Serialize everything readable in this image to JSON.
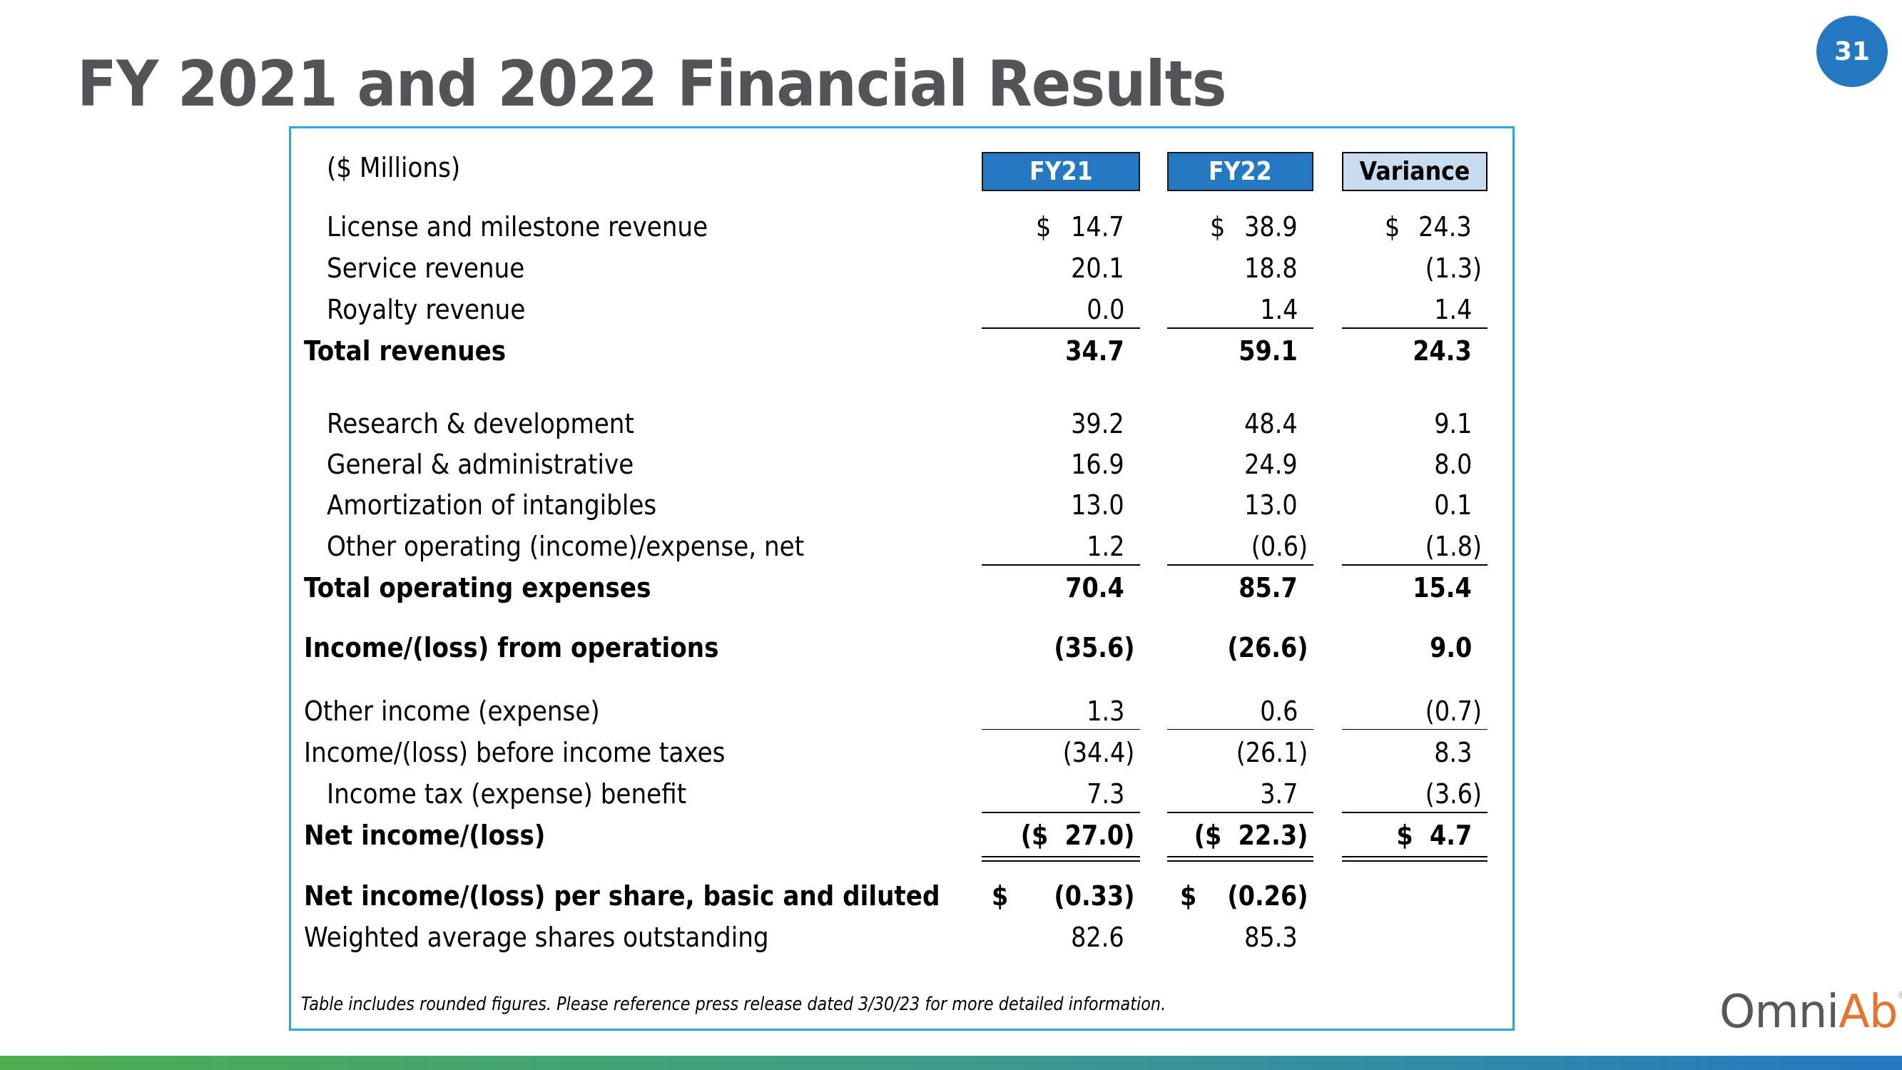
{
  "page": {
    "title": "FY 2021 and 2022 Financial Results",
    "page_number": "31"
  },
  "table": {
    "units_label": "($ Millions)",
    "columns": [
      "FY21",
      "FY22",
      "Variance"
    ],
    "rows": [
      {
        "label": "License and milestone revenue",
        "fy21": {
          "cur": "$",
          "val": "14.7"
        },
        "fy22": {
          "cur": "$",
          "val": "38.9"
        },
        "var": {
          "cur": "$",
          "val": "24.3"
        }
      },
      {
        "label": "Service revenue",
        "fy21": {
          "val": "20.1"
        },
        "fy22": {
          "val": "18.8"
        },
        "var": {
          "val": "(1.3)"
        }
      },
      {
        "label": "Royalty revenue",
        "fy21": {
          "val": "0.0"
        },
        "fy22": {
          "val": "1.4"
        },
        "var": {
          "val": "1.4"
        }
      },
      {
        "label": "Total revenues",
        "fy21": {
          "val": "34.7"
        },
        "fy22": {
          "val": "59.1"
        },
        "var": {
          "val": "24.3"
        }
      },
      {
        "label": "Research & development",
        "fy21": {
          "val": "39.2"
        },
        "fy22": {
          "val": "48.4"
        },
        "var": {
          "val": "9.1"
        }
      },
      {
        "label": "General & administrative",
        "fy21": {
          "val": "16.9"
        },
        "fy22": {
          "val": "24.9"
        },
        "var": {
          "val": "8.0"
        }
      },
      {
        "label": "Amortization of intangibles",
        "fy21": {
          "val": "13.0"
        },
        "fy22": {
          "val": "13.0"
        },
        "var": {
          "val": "0.1"
        }
      },
      {
        "label": "Other operating (income)/expense, net",
        "fy21": {
          "val": "1.2"
        },
        "fy22": {
          "val": "(0.6)"
        },
        "var": {
          "val": "(1.8)"
        }
      },
      {
        "label": "Total operating expenses",
        "fy21": {
          "val": "70.4"
        },
        "fy22": {
          "val": "85.7"
        },
        "var": {
          "val": "15.4"
        }
      },
      {
        "label": "Income/(loss) from operations",
        "fy21": {
          "val": "(35.6)"
        },
        "fy22": {
          "val": "(26.6)"
        },
        "var": {
          "val": "9.0"
        }
      },
      {
        "label": "Other income (expense)",
        "fy21": {
          "val": "1.3"
        },
        "fy22": {
          "val": "0.6"
        },
        "var": {
          "val": "(0.7)"
        }
      },
      {
        "label": "Income/(loss) before income taxes",
        "fy21": {
          "val": "(34.4)"
        },
        "fy22": {
          "val": "(26.1)"
        },
        "var": {
          "val": "8.3"
        }
      },
      {
        "label": "Income tax (expense) benefit",
        "fy21": {
          "val": "7.3"
        },
        "fy22": {
          "val": "3.7"
        },
        "var": {
          "val": "(3.6)"
        }
      },
      {
        "label": "Net income/(loss)",
        "fy21": {
          "val": "($  27.0)"
        },
        "fy22": {
          "val": "($  22.3)"
        },
        "var": {
          "val": "$  4.7"
        }
      },
      {
        "label": "Net income/(loss) per share, basic and diluted",
        "fy21": {
          "cur": "$",
          "val": "(0.33)"
        },
        "fy22": {
          "cur": "$",
          "val": "(0.26)"
        },
        "var": {
          "val": ""
        }
      },
      {
        "label": "Weighted average shares outstanding",
        "fy21": {
          "val": "82.6"
        },
        "fy22": {
          "val": "85.3"
        },
        "var": {
          "val": ""
        }
      }
    ],
    "footnote": "Table includes rounded figures.  Please reference press release dated 3/30/23 for more detailed information."
  },
  "logo": {
    "part1": "Omni",
    "part2": "Ab",
    "registered": "®"
  },
  "colors": {
    "title": "#545458",
    "accent_blue": "#2479C2",
    "variance_header": "#C9DBF0",
    "box_border": "#29A8E0",
    "logo_orange": "#E8732A",
    "bar_green": "#4DAE4F"
  }
}
